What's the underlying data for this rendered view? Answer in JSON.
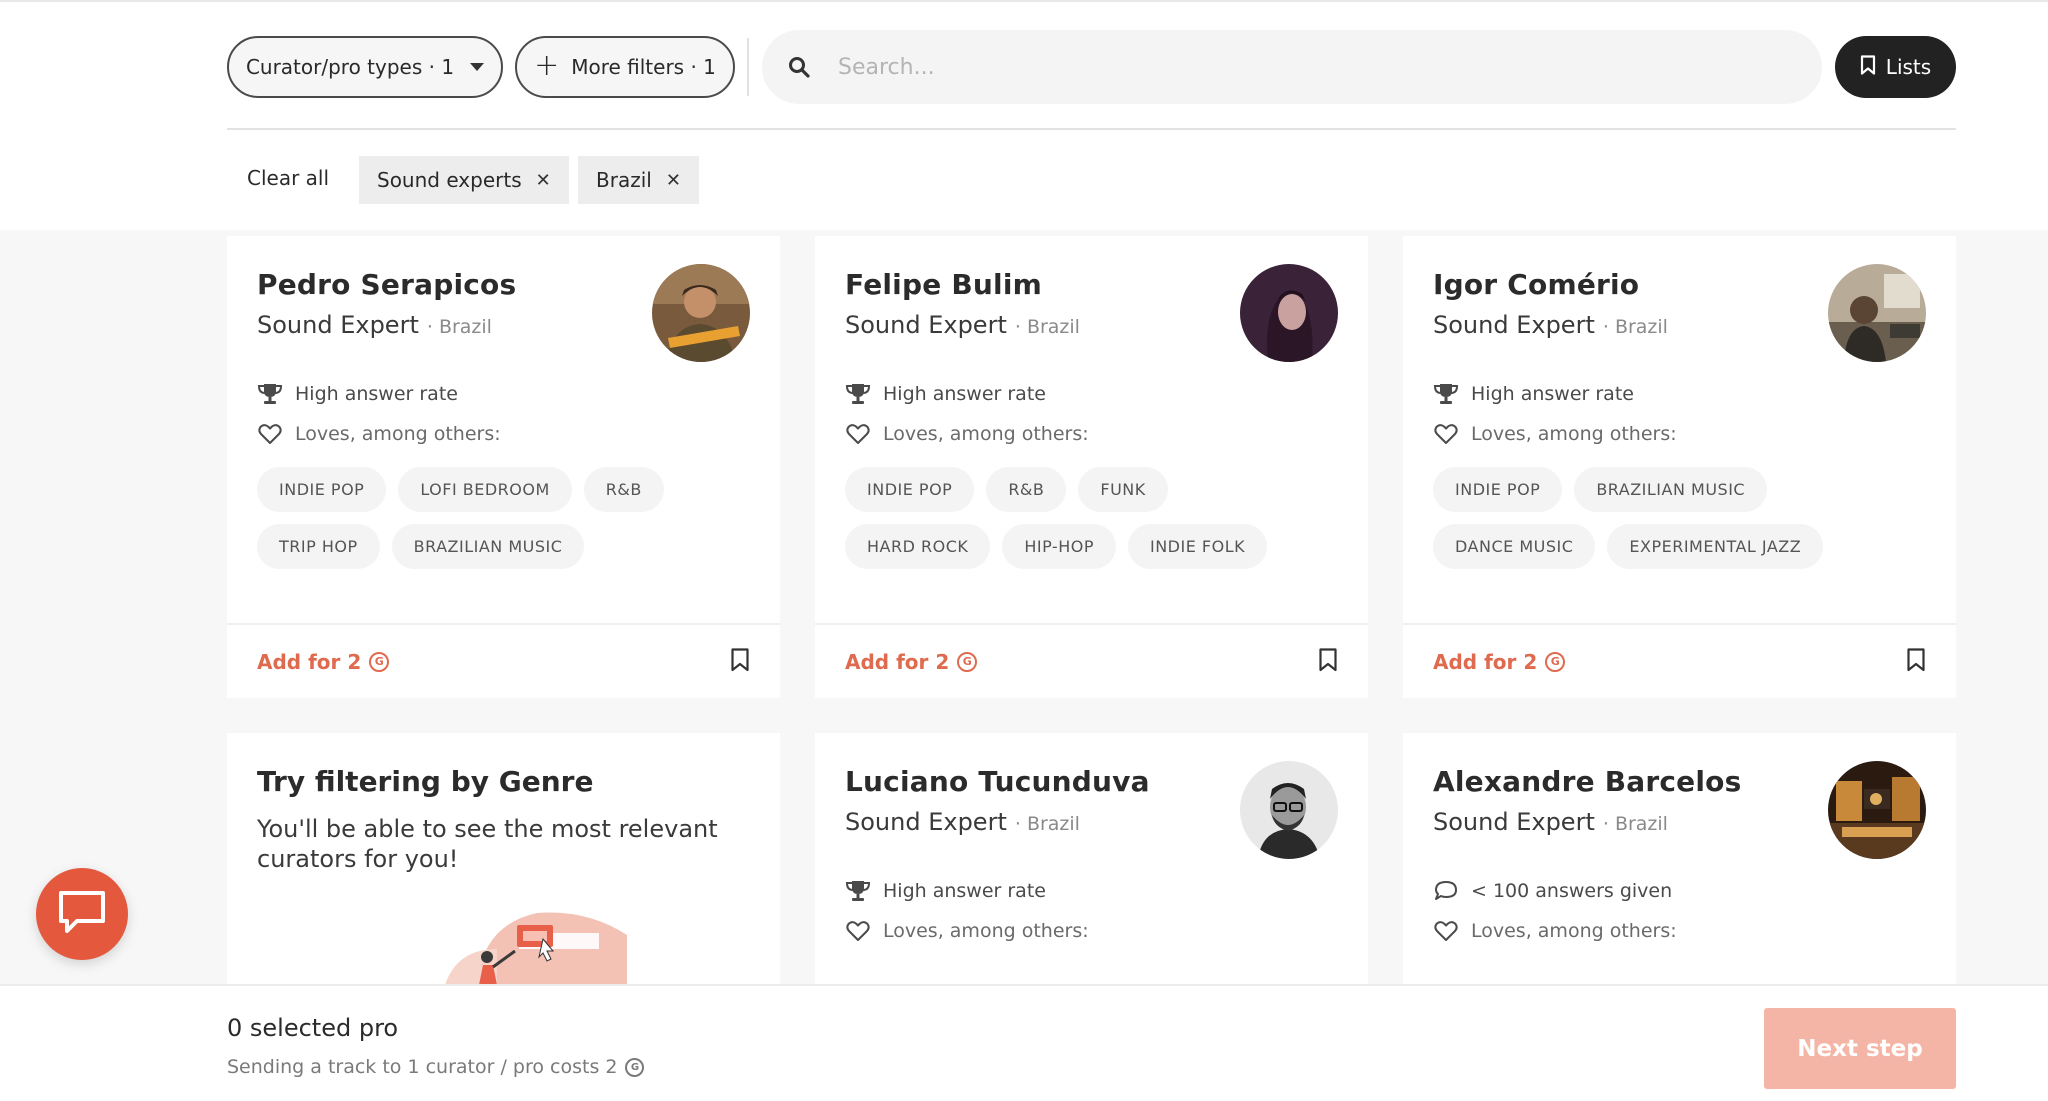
{
  "filters": {
    "curator_types_label": "Curator/pro types · 1",
    "more_filters_label": "More filters · 1",
    "search_placeholder": "Search...",
    "lists_label": "Lists",
    "clear_all_label": "Clear all",
    "active": [
      {
        "label": "Sound experts"
      },
      {
        "label": "Brazil"
      }
    ]
  },
  "cards": [
    {
      "name": "Pedro Serapicos",
      "role": "Sound Expert",
      "country": "· Brazil",
      "stat": "High answer rate",
      "loves": "Loves, among others:",
      "tags": [
        "INDIE POP",
        "LOFI BEDROOM",
        "R&B",
        "TRIP HOP",
        "BRAZILIAN MUSIC"
      ],
      "add_label": "Add for 2"
    },
    {
      "name": "Felipe Bulim",
      "role": "Sound Expert",
      "country": "· Brazil",
      "stat": "High answer rate",
      "loves": "Loves, among others:",
      "tags": [
        "INDIE POP",
        "R&B",
        "FUNK",
        "HARD ROCK",
        "HIP-HOP",
        "INDIE FOLK"
      ],
      "add_label": "Add for 2"
    },
    {
      "name": "Igor Comério",
      "role": "Sound Expert",
      "country": "· Brazil",
      "stat": "High answer rate",
      "loves": "Loves, among others:",
      "tags": [
        "INDIE POP",
        "BRAZILIAN MUSIC",
        "DANCE MUSIC",
        "EXPERIMENTAL JAZZ"
      ],
      "add_label": "Add for 2"
    },
    {
      "name": "Luciano Tucunduva",
      "role": "Sound Expert",
      "country": "· Brazil",
      "stat": "High answer rate",
      "loves": "Loves, among others:"
    },
    {
      "name": "Alexandre Barcelos",
      "role": "Sound Expert",
      "country": "· Brazil",
      "stat": "< 100 answers given",
      "loves": "Loves, among others:"
    }
  ],
  "promo": {
    "title": "Try filtering by Genre",
    "text": "You'll be able to see the most relevant curators for you!"
  },
  "footer": {
    "selected": "0 selected pro",
    "info": "Sending a track to 1 curator / pro costs 2",
    "next_label": "Next step"
  },
  "icons": {
    "coin": "coin-icon",
    "trophy": "trophy-icon",
    "heart": "heart-icon",
    "bookmark": "bookmark-icon",
    "chat": "chat-icon"
  },
  "colors": {
    "accent": "#e06a4e",
    "chat_button": "#e4593d",
    "next_button_disabled": "#f5b5a6",
    "dark_button": "#222222"
  }
}
